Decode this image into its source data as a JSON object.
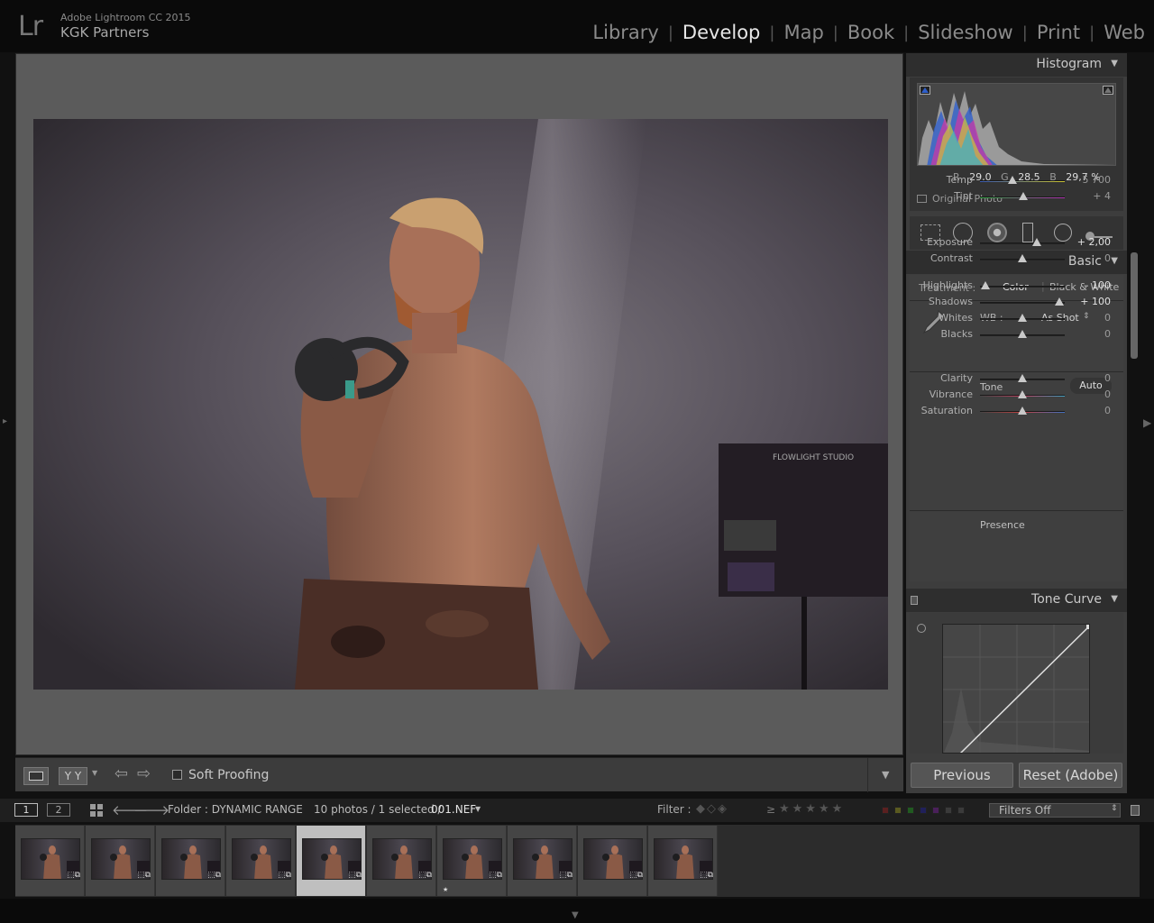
{
  "app": {
    "logo": "Lr",
    "name": "Adobe Lightroom CC 2015",
    "identity": "KGK Partners"
  },
  "modules": [
    "Library",
    "Develop",
    "Map",
    "Book",
    "Slideshow",
    "Print",
    "Web"
  ],
  "active_module": "Develop",
  "toolbar": {
    "soft_proofing_label": "Soft Proofing",
    "soft_proofing_checked": false,
    "compare_label": "Y Y"
  },
  "histogram": {
    "title": "Histogram",
    "r_label": "R",
    "r_value": "29,0",
    "g_label": "G",
    "g_value": "28,5",
    "b_label": "B",
    "b_value": "29,7 %",
    "original_photo_label": "Original Photo"
  },
  "basic": {
    "title": "Basic",
    "treatment_label": "Treatment :",
    "treatment_color": "Color",
    "treatment_bw": "Black & White",
    "wb_label": "WB :",
    "wb_value": "As Shot",
    "tone_label": "Tone",
    "auto_label": "Auto",
    "presence_label": "Presence",
    "sliders": [
      {
        "label": "Temp",
        "value": "5 700",
        "pos": 0.38
      },
      {
        "label": "Tint",
        "value": "+ 4",
        "pos": 0.51
      },
      {
        "label": "Exposure",
        "value": "+ 2,00",
        "pos": 0.67
      },
      {
        "label": "Contrast",
        "value": "0",
        "pos": 0.5
      },
      {
        "label": "Highlights",
        "value": "– 100",
        "pos": 0.06
      },
      {
        "label": "Shadows",
        "value": "+ 100",
        "pos": 0.94
      },
      {
        "label": "Whites",
        "value": "0",
        "pos": 0.5
      },
      {
        "label": "Blacks",
        "value": "0",
        "pos": 0.5
      },
      {
        "label": "Clarity",
        "value": "0",
        "pos": 0.5
      },
      {
        "label": "Vibrance",
        "value": "0",
        "pos": 0.5
      },
      {
        "label": "Saturation",
        "value": "0",
        "pos": 0.5
      }
    ]
  },
  "tone_curve": {
    "title": "Tone Curve"
  },
  "buttons": {
    "previous": "Previous",
    "reset": "Reset (Adobe)"
  },
  "filmbar": {
    "view1": "1",
    "view2": "2",
    "folder_label": "Folder : DYNAMIC RANGE",
    "count_label": "10 photos / 1 selected /",
    "file_name": "001.NEF",
    "filter_label": "Filter :",
    "filters_off": "Filters Off",
    "gte": "≥",
    "stars": "★★★★★"
  },
  "filmstrip": {
    "count": 10,
    "selected_index": 4,
    "starred_index": 6,
    "star_mark": "★"
  },
  "colors": {
    "accent": "#e6e6e6",
    "panel": "#3d3d3d",
    "viewport": "#5b5b5b"
  }
}
